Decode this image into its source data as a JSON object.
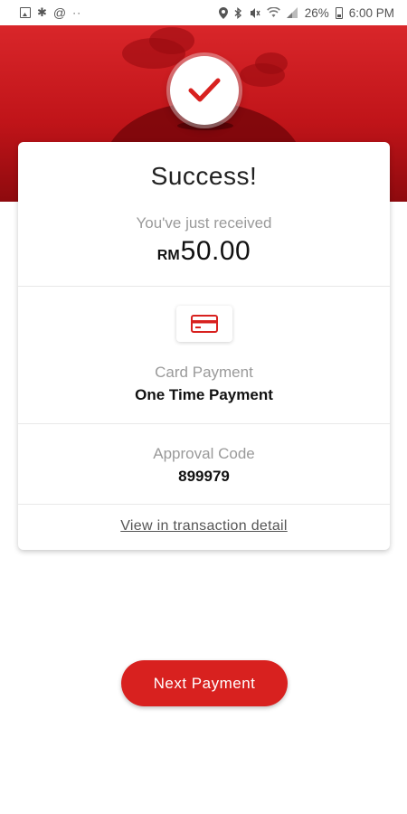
{
  "status_bar": {
    "battery_percent": "26%",
    "time": "6:00 PM",
    "left_icons": [
      "image-icon",
      "pinwheel-icon",
      "at-icon",
      "more-dots-icon"
    ],
    "right_icons": [
      "location-icon",
      "bluetooth-icon",
      "mute-icon",
      "wifi-icon",
      "signal-icon",
      "battery-icon"
    ]
  },
  "header": {
    "icon": "checkmark-icon",
    "accent_color": "#d8211f"
  },
  "card": {
    "title": "Success!",
    "received_label": "You've just received",
    "amount": {
      "currency": "RM",
      "value": "50.00"
    },
    "payment_method": {
      "icon": "credit-card-icon",
      "label": "Card Payment",
      "value": "One Time Payment"
    },
    "approval": {
      "label": "Approval Code",
      "value": "899979"
    },
    "detail_link": "View in transaction detail"
  },
  "actions": {
    "next_label": "Next Payment"
  }
}
